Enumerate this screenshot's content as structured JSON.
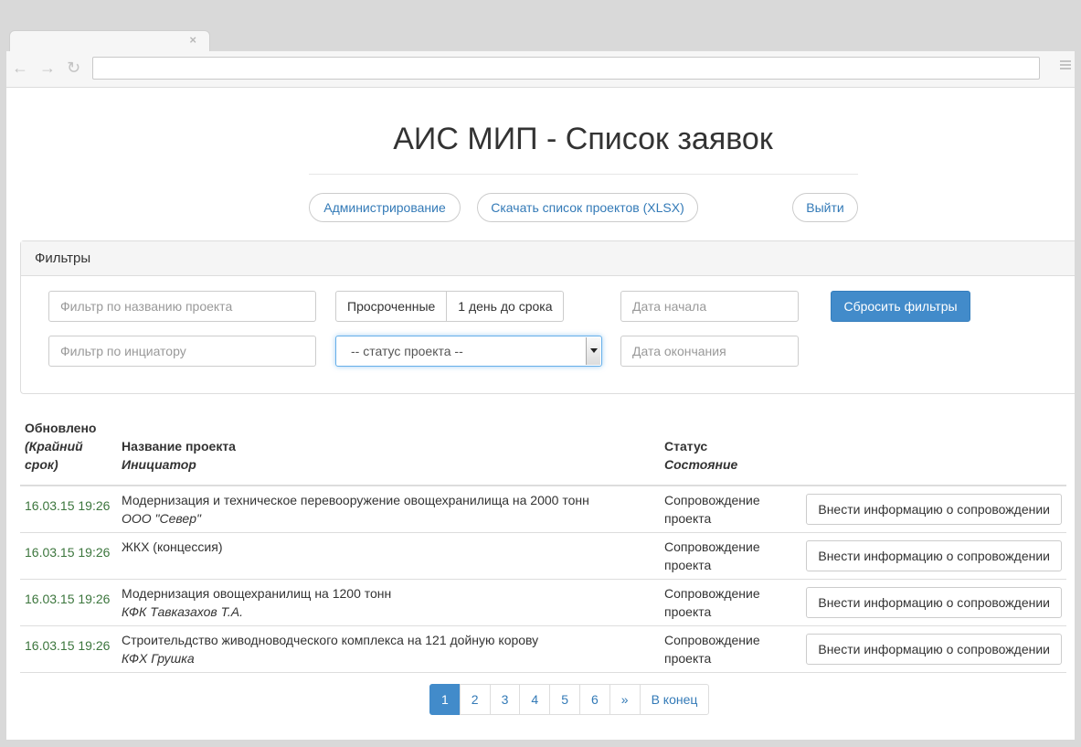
{
  "browser": {
    "tab_close": "×",
    "back": "←",
    "forward": "→",
    "reload": "↻",
    "address": ""
  },
  "header": {
    "title": "АИС МИП - Список заявок",
    "nav": {
      "admin": "Администрирование",
      "download": "Скачать список проектов (XLSX)",
      "logout": "Выйти"
    }
  },
  "filters": {
    "heading": "Фильтры",
    "project_name_placeholder": "Фильтр по названию проекта",
    "initiator_placeholder": "Фильтр по инциатору",
    "overdue_label": "Просроченные",
    "one_day_label": "1 день до срока",
    "status_select": "-- статус проекта --",
    "date_start_placeholder": "Дата начала",
    "date_end_placeholder": "Дата окончания",
    "reset_label": "Сбросить фильтры"
  },
  "table": {
    "headers": {
      "updated": "Обновлено",
      "deadline": "(Крайний срок)",
      "project": "Название проекта",
      "initiator": "Инициатор",
      "status": "Статус",
      "state": "Состояние"
    },
    "rows": [
      {
        "date": "16.03.15 19:26",
        "project": "Модернизация и техническое перевооружение овощехранилища на 2000 тонн",
        "initiator": "ООО \"Север\"",
        "status": "Сопровождение проекта",
        "action": "Внести информацию о сопровождении"
      },
      {
        "date": "16.03.15 19:26",
        "project": "ЖКХ (концессия)",
        "initiator": "",
        "status": "Сопровождение проекта",
        "action": "Внести информацию о сопровождении"
      },
      {
        "date": "16.03.15 19:26",
        "project": "Модернизация овощехранилищ на 1200 тонн",
        "initiator": "КФК Тавказахов Т.А.",
        "status": "Сопровождение проекта",
        "action": "Внести информацию о сопровождении"
      },
      {
        "date": "16.03.15 19:26",
        "project": "Строительдство живодноводческого комплекса на 121 дойную корову",
        "initiator": "КФХ Грушка",
        "status": "Сопровождение проекта",
        "action": "Внести информацию о сопровождении"
      }
    ]
  },
  "pagination": {
    "pages": [
      "1",
      "2",
      "3",
      "4",
      "5",
      "6"
    ],
    "next": "»",
    "last": "В конец",
    "active": "1"
  }
}
